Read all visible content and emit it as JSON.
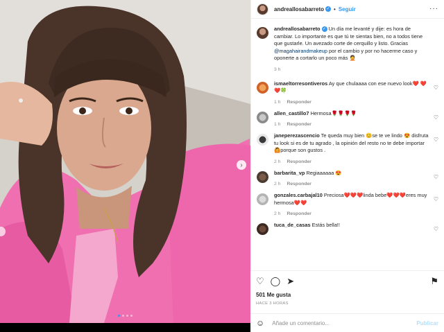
{
  "post": {
    "username": "andreallosabarreto",
    "verified_mark": "✓",
    "follow_label": "Seguir",
    "separator": "•",
    "more_icon": "···"
  },
  "caption": {
    "username": "andreallosabarreto",
    "text_before_mention": "Un día me levanté y dije: es hora de cambiar. Lo importante es que tú te sientas bien, no a todos tiene que gustarle. Un avezado corte de cerquillo y listo. Gracias ",
    "mention": "@magahairandmakeup",
    "text_after_mention": " por el cambio y por no hacerme caso y oponerte a cortarlo un poco más 🤦",
    "time": "3 h"
  },
  "reply_label": "Responder",
  "comments": [
    {
      "username": "ismaeltorresontiveros",
      "text": "Ay que chulaaaa con ese nuevo look❤️ ❤️❤️🍀",
      "time": "1 h"
    },
    {
      "username": "allen_castillo7",
      "text": "Hermosa🌹🌹🌹🌹",
      "time": "1 h"
    },
    {
      "username": "janeperezascencio",
      "text": "Te queda muy bien 😊se te ve lindo 😍 disfruta tu look si es de tu agrado , la opinión del resto no te debe importar 🙆porque son gustos .",
      "time": "2 h"
    },
    {
      "username": "barbarita_vp",
      "text": "Regiaaaaaa 😍",
      "time": "2 h"
    },
    {
      "username": "gonzales.carbajal10",
      "text": "Preciosa❤️❤️❤️linda bebe❤️❤️❤️eres muy hermosa❤️❤️",
      "time": "2 h"
    },
    {
      "username": "tuca_de_casas",
      "text": "Estás bella!!",
      "time": ""
    }
  ],
  "actions": {
    "like_icon": "♡",
    "comment_icon": "◯",
    "share_icon": "➤",
    "save_icon": "⚑",
    "likes": "501 Me gusta",
    "time_ago": "HACE 3 HORAS"
  },
  "add_comment": {
    "emoji_icon": "☺",
    "placeholder": "Añade un comentario...",
    "publish_label": "Publicar"
  },
  "colors": {
    "accent": "#3897f0",
    "shirt": "#f06fb0"
  }
}
